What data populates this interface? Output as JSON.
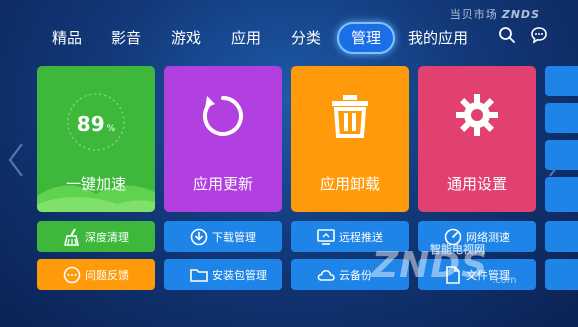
{
  "brand": {
    "name": "当贝市场",
    "suffix": "ZNDS"
  },
  "nav": {
    "tabs": [
      {
        "label": "精品"
      },
      {
        "label": "影音"
      },
      {
        "label": "游戏"
      },
      {
        "label": "应用"
      },
      {
        "label": "分类"
      },
      {
        "label": "管理"
      },
      {
        "label": "我的应用"
      }
    ],
    "active_tab": "管理",
    "icons": [
      "search-icon",
      "message-icon"
    ]
  },
  "cards": [
    {
      "label": "一键加速",
      "value": "89",
      "unit": "%",
      "color": "#3db83a"
    },
    {
      "label": "应用更新",
      "icon": "refresh-icon",
      "color": "#b23fe0"
    },
    {
      "label": "应用卸载",
      "icon": "trash-icon",
      "color": "#ff9a0a"
    },
    {
      "label": "通用设置",
      "icon": "gear-icon",
      "color": "#e0416f"
    }
  ],
  "buttons_row1": [
    {
      "label": "深度清理",
      "icon": "broom-icon",
      "color": "#3db83a"
    },
    {
      "label": "下载管理",
      "icon": "download-icon",
      "color": "#1f84e8"
    },
    {
      "label": "远程推送",
      "icon": "screen-share-icon",
      "color": "#1f84e8"
    },
    {
      "label": "网络测速",
      "icon": "speed-icon",
      "color": "#1f84e8"
    }
  ],
  "buttons_row2": [
    {
      "label": "问题反馈",
      "icon": "chat-icon",
      "color": "#ff9a0a"
    },
    {
      "label": "安装包管理",
      "icon": "folder-icon",
      "color": "#1f84e8"
    },
    {
      "label": "云备份",
      "icon": "cloud-icon",
      "color": "#1f84e8"
    },
    {
      "label": "文件管理",
      "icon": "file-icon",
      "color": "#1f84e8"
    }
  ],
  "watermark": {
    "text": "ZNDS",
    "subtitle": "智能电视网",
    "site": ".com"
  }
}
